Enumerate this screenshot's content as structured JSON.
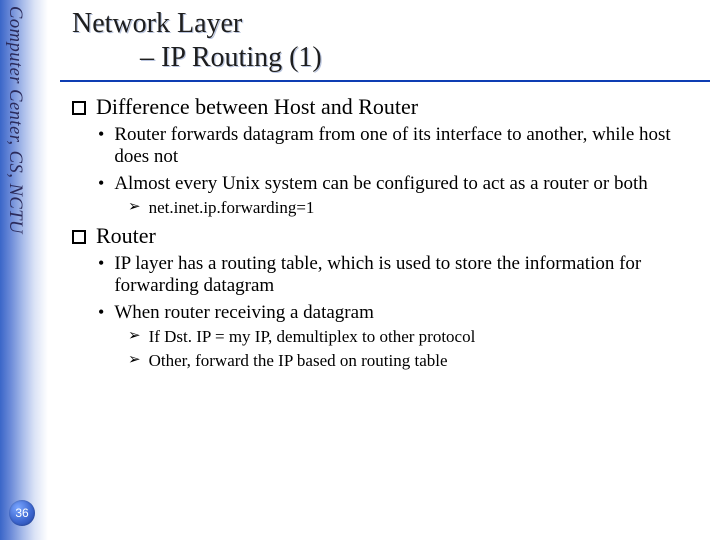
{
  "sidebar": {
    "org_text": "Computer Center, CS, NCTU"
  },
  "page_number": "36",
  "title": {
    "line1": "Network Layer",
    "line2": "– IP Routing (1)"
  },
  "sections": [
    {
      "heading": "Difference between Host and Router",
      "bullets": [
        {
          "text": "Router forwards datagram from one of its interface to another, while host does not",
          "arrows": []
        },
        {
          "text": "Almost every Unix system can be configured to act as a router or both",
          "arrows": [
            "net.inet.ip.forwarding=1"
          ]
        }
      ]
    },
    {
      "heading": "Router",
      "bullets": [
        {
          "text": "IP layer has a routing table, which is used to store the information for forwarding datagram",
          "arrows": []
        },
        {
          "text": "When router receiving a datagram",
          "arrows": [
            "If Dst. IP = my IP, demultiplex to other protocol",
            "Other, forward the IP based on routing table"
          ]
        }
      ]
    }
  ]
}
